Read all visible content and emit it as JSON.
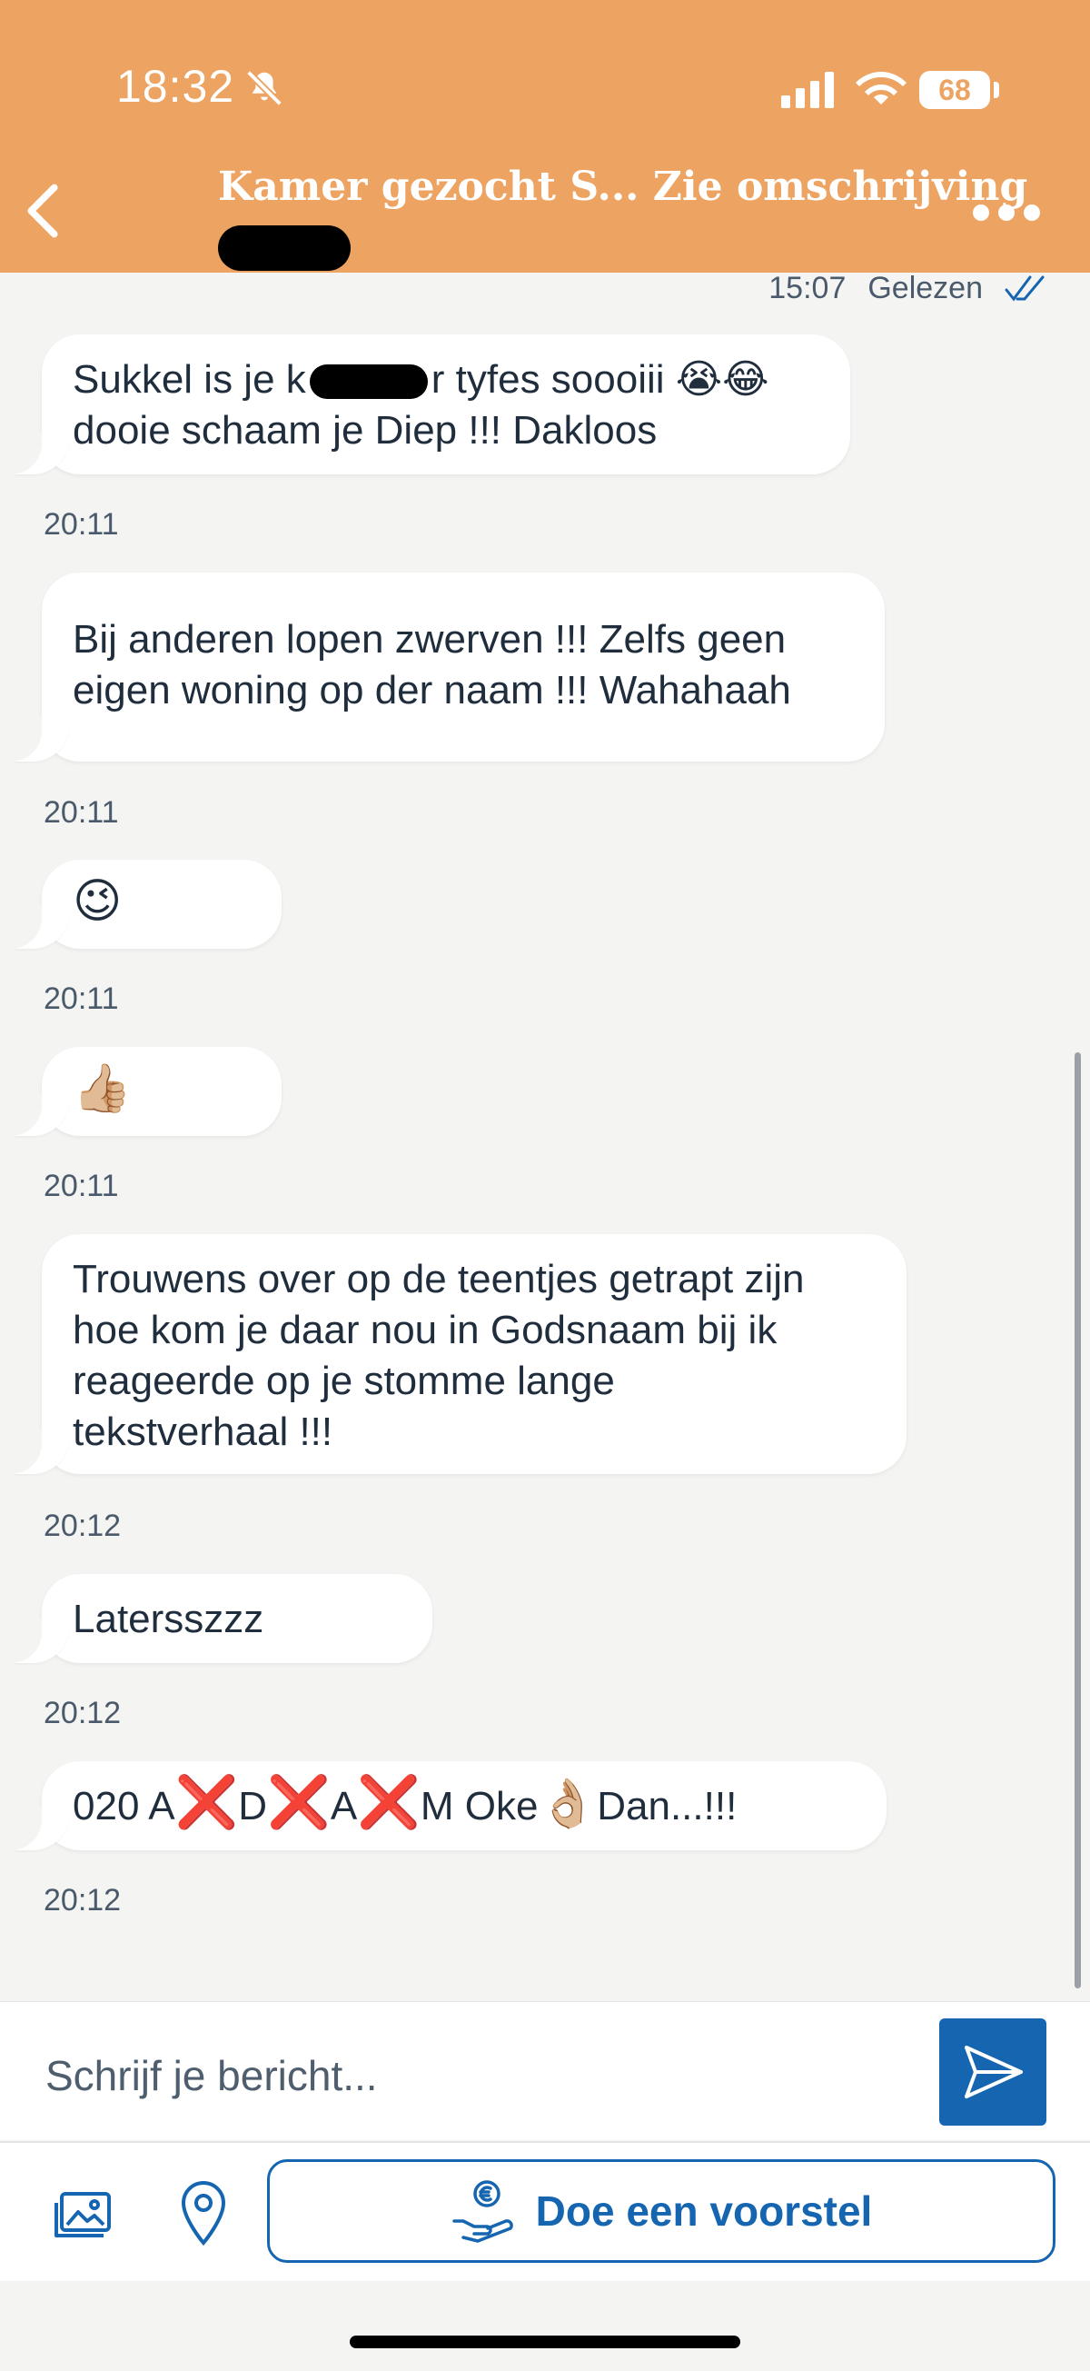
{
  "status_bar": {
    "time": "18:32",
    "battery": "68"
  },
  "header": {
    "title": "Kamer gezocht S... Zie omschrijving"
  },
  "read_receipt": {
    "time": "15:07",
    "status": "Gelezen"
  },
  "messages": [
    {
      "text_before": "Sukkel is je k",
      "text_after": "r tyfes soooiii 😭😂\ndooie schaam je Diep !!! Dakloos",
      "time": "20:11"
    },
    {
      "text": "Bij anderen lopen zwerven !!! Zelfs geen\neigen woning op der naam !!! Wahahaah",
      "time": "20:11"
    },
    {
      "text": "😉",
      "time": "20:11"
    },
    {
      "text": "👍🏼",
      "time": "20:11"
    },
    {
      "text": "Trouwens over op de teentjes getrapt zijn\nhoe kom je daar nou in Godsnaam bij ik\nreageerde op je stomme lange\ntekstverhaal !!!",
      "time": "20:12"
    },
    {
      "text": "Latersszzz",
      "time": "20:12"
    },
    {
      "parts": [
        "020 A",
        "❌",
        "D",
        "❌",
        "A",
        "❌",
        "M Oke",
        "👌🏼",
        "Dan...!!!"
      ],
      "time": "20:12"
    }
  ],
  "composer": {
    "placeholder": "Schrijf je bericht..."
  },
  "actions": {
    "offer_label": "Doe een voorstel"
  },
  "icons": {
    "bell": "bell-slash-icon",
    "signal": "signal-icon",
    "wifi": "wifi-icon",
    "back": "chevron-left-icon",
    "more": "more-dots-icon",
    "read": "double-check-icon",
    "send": "send-icon",
    "photo": "photo-gallery-icon",
    "location": "location-pin-icon",
    "offer": "euro-hand-icon"
  },
  "colors": {
    "header": "#eda462",
    "accent": "#1565b0",
    "background": "#f4f4f2",
    "cross": "#e01020"
  }
}
